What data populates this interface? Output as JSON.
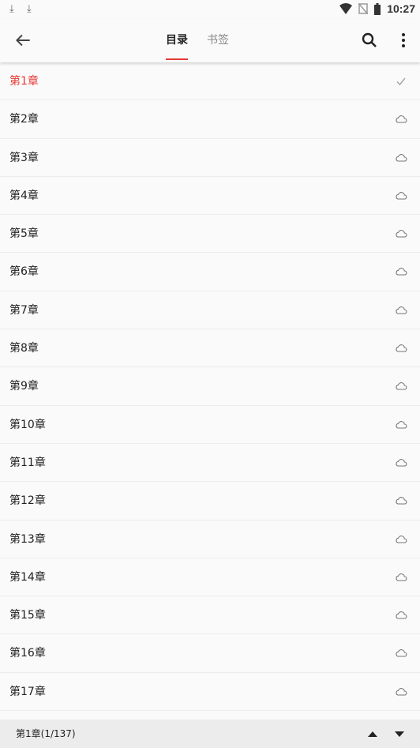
{
  "status_bar": {
    "time": "10:27"
  },
  "toolbar": {
    "tabs": [
      {
        "label": "目录",
        "active": true
      },
      {
        "label": "书签",
        "active": false
      }
    ]
  },
  "colors": {
    "accent": "#e53935"
  },
  "chapters": [
    {
      "title": "第1章",
      "state": "check-icon"
    },
    {
      "title": "第2章",
      "state": "cloud-icon"
    },
    {
      "title": "第3章",
      "state": "cloud-icon"
    },
    {
      "title": "第4章",
      "state": "cloud-icon"
    },
    {
      "title": "第5章",
      "state": "cloud-icon"
    },
    {
      "title": "第6章",
      "state": "cloud-icon"
    },
    {
      "title": "第7章",
      "state": "cloud-icon"
    },
    {
      "title": "第8章",
      "state": "cloud-icon"
    },
    {
      "title": "第9章",
      "state": "cloud-icon"
    },
    {
      "title": "第10章",
      "state": "cloud-icon"
    },
    {
      "title": "第11章",
      "state": "cloud-icon"
    },
    {
      "title": "第12章",
      "state": "cloud-icon"
    },
    {
      "title": "第13章",
      "state": "cloud-icon"
    },
    {
      "title": "第14章",
      "state": "cloud-icon"
    },
    {
      "title": "第15章",
      "state": "cloud-icon"
    },
    {
      "title": "第16章",
      "state": "cloud-icon"
    },
    {
      "title": "第17章",
      "state": "cloud-icon"
    }
  ],
  "footer": {
    "position_text": "第1章(1/137)"
  }
}
